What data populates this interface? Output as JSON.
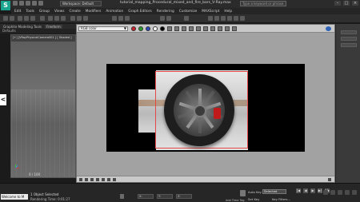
{
  "app": {
    "logo_text": "S",
    "workspace": "Workspace: Default",
    "document_title": "tutorial_mapping_Procedural_mixed_and_fire_bars_V-Ray.max",
    "search_placeholder": "Type a keyword or phrase",
    "window_buttons": [
      "–",
      "□",
      "×"
    ]
  },
  "menu": [
    "Edit",
    "Tools",
    "Group",
    "Views",
    "Create",
    "Modifiers",
    "Animation",
    "Graph Editors",
    "Rendering",
    "Customize",
    "MAXScript",
    "Help"
  ],
  "ribbon": {
    "tabs": [
      "Graphite Modeling Tools",
      "Freeform"
    ],
    "active_tab": "Freeform",
    "subtitle": "Defaults"
  },
  "left_viewport": {
    "label": "[+] [VRayPhysicalCamera001 ] [ Shaded ]",
    "timeline_label": "0 / 100",
    "side_handle": "<"
  },
  "frame_buffer": {
    "title": "V-Ray frame buffer",
    "channel": "RGB color",
    "tool_colors": [
      "#c8202a",
      "#2d9b2d",
      "#2b49b8",
      "#ffffff",
      "#000000"
    ]
  },
  "status_bar": {
    "prompt": "Welcome to M",
    "selection": "1 Object Selected",
    "render_time": "Rendering Time: 0:01:27",
    "coords": {
      "x": "X: ",
      "y": "Y: ",
      "z": "Z: "
    },
    "add_time_tag": "Add Time Tag",
    "auto_key": "Auto Key",
    "selected_dropdown": "Selected",
    "set_key": "Set Key",
    "key_filters": "Key Filters...",
    "playback": [
      "|◀",
      "◀",
      "▶",
      "▶|",
      "▶▶"
    ]
  }
}
